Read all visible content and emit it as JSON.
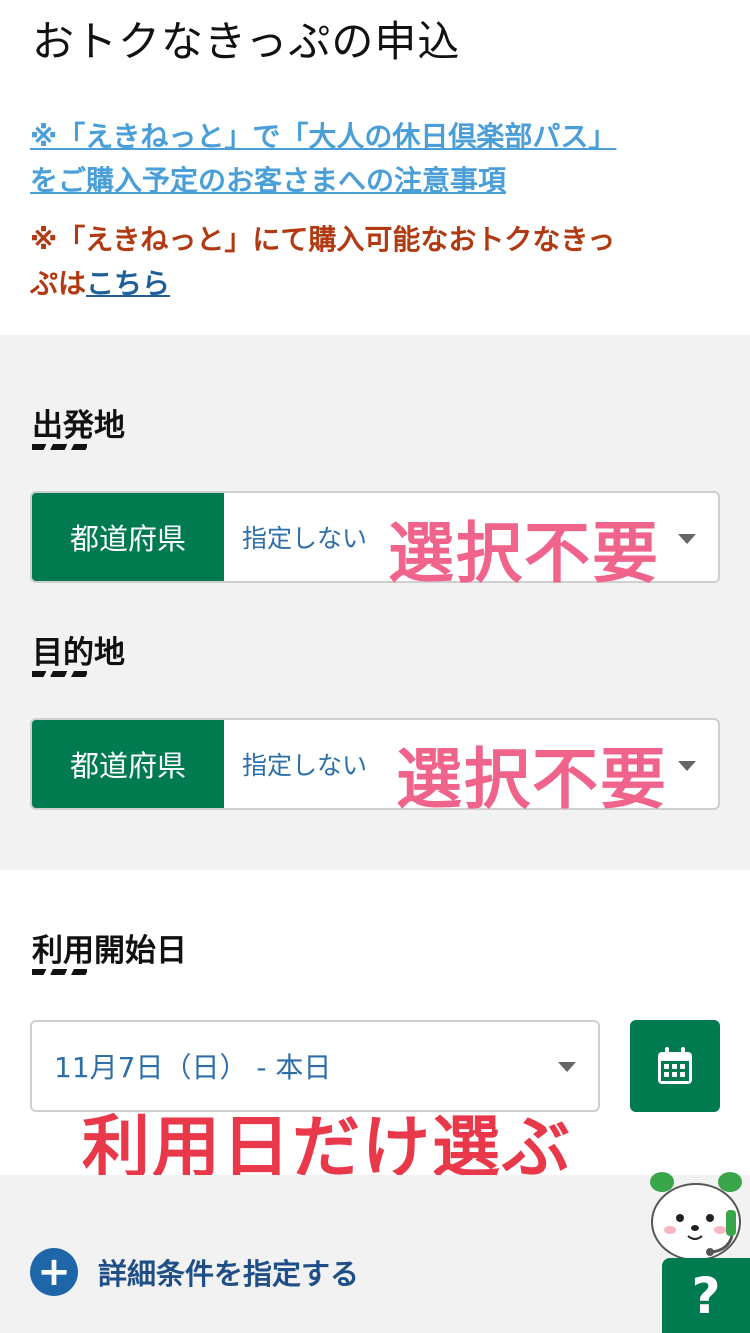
{
  "page": {
    "title": "おトクなきっぷの申込"
  },
  "notices": {
    "link_line1": "※「えきねっと」で「大人の休日倶楽部パス」",
    "link_line2": "をご購入予定のお客さまへの注意事項",
    "red_line1": "※「えきねっと」にて購入可能なおトクなきっ",
    "red_line2_prefix": "ぷは",
    "red_link": "こちら"
  },
  "departure": {
    "heading": "出発地",
    "pref_label": "都道府県",
    "value": "指定しない",
    "annotation": "選択不要"
  },
  "destination": {
    "heading": "目的地",
    "pref_label": "都道府県",
    "value": "指定しない",
    "annotation": "選択不要"
  },
  "start_date": {
    "heading": "利用開始日",
    "value": "11月7日（日） - 本日",
    "annotation": "利用日だけ選ぶ"
  },
  "details": {
    "label": "詳細条件を指定する"
  },
  "help": {
    "label": "?"
  },
  "colors": {
    "brand_green": "#007a4f",
    "link_blue": "#4a9fd8",
    "notice_red": "#b23a12",
    "annotation_pink": "#f0648c",
    "annotation_red": "#e8384a"
  }
}
